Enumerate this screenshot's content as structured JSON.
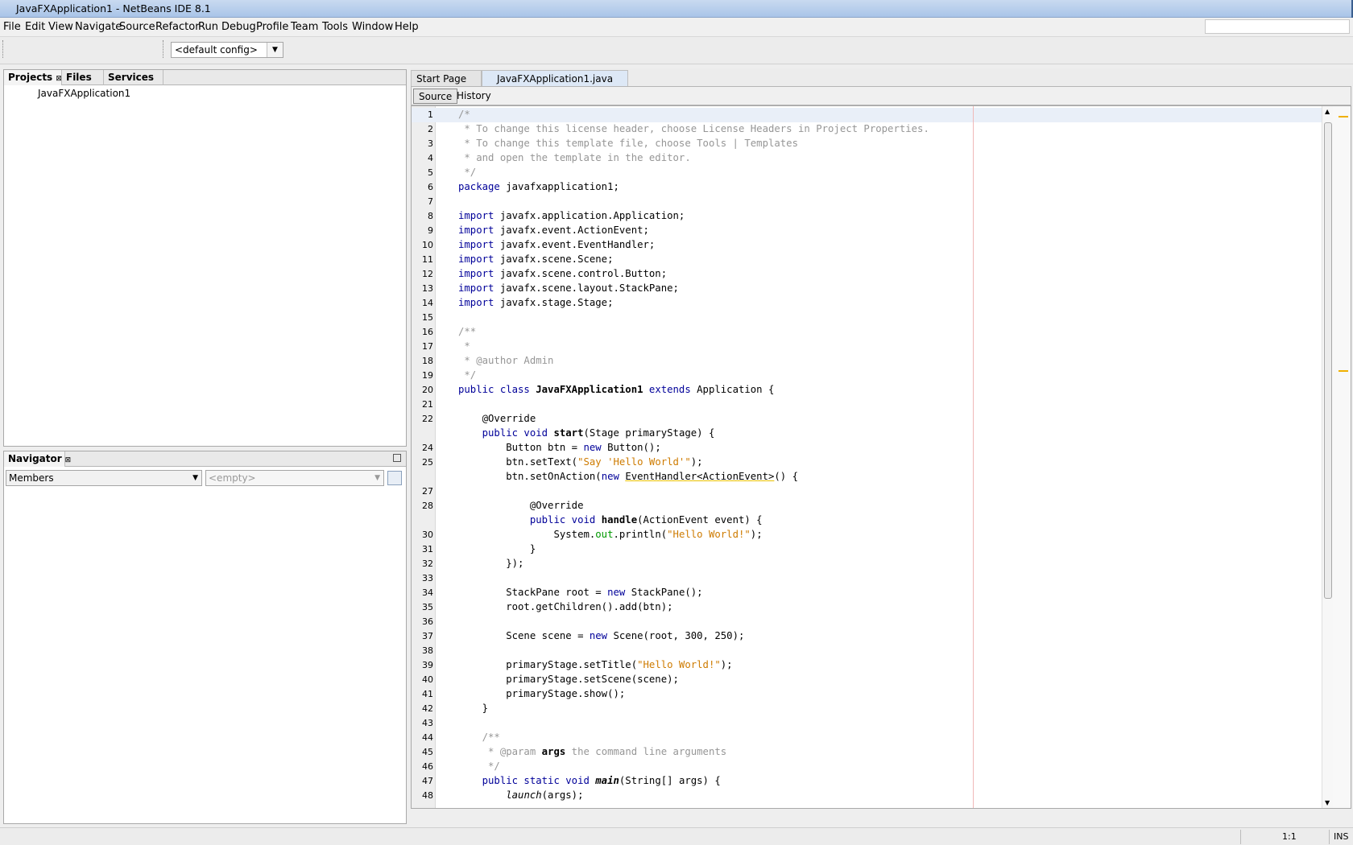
{
  "window": {
    "title": "JavaFXApplication1 - NetBeans IDE 8.1"
  },
  "menu": [
    "File",
    "Edit",
    "View",
    "Navigate",
    "Source",
    "Refactor",
    "Run",
    "Debug",
    "Profile",
    "Team",
    "Tools",
    "Window",
    "Help"
  ],
  "toolbar": {
    "config_value": "<default config>"
  },
  "projects_panel": {
    "tabs": [
      "Projects",
      "Files",
      "Services"
    ],
    "tree": [
      "JavaFXApplication1"
    ]
  },
  "navigator_panel": {
    "title": "Navigator",
    "filter_value": "Members",
    "empty_value": "<empty>"
  },
  "editor": {
    "tabs": [
      "Start Page",
      "JavaFXApplication1.java"
    ],
    "subtabs": [
      "Source",
      "History"
    ],
    "cursor_position": "1:1",
    "insert_mode": "INS",
    "lines": [
      {
        "n": "1",
        "code": [
          [
            "cm",
            "/*"
          ]
        ]
      },
      {
        "n": "2",
        "code": [
          [
            "cm",
            " * To change this license header, choose License Headers in Project Properties."
          ]
        ]
      },
      {
        "n": "3",
        "code": [
          [
            "cm",
            " * To change this template file, choose Tools | Templates"
          ]
        ]
      },
      {
        "n": "4",
        "code": [
          [
            "cm",
            " * and open the template in the editor."
          ]
        ]
      },
      {
        "n": "5",
        "code": [
          [
            "cm",
            " */"
          ]
        ]
      },
      {
        "n": "6",
        "code": [
          [
            "kw",
            "package"
          ],
          [
            "",
            " javafxapplication1;"
          ]
        ]
      },
      {
        "n": "7",
        "code": []
      },
      {
        "n": "8",
        "code": [
          [
            "kw",
            "import"
          ],
          [
            "",
            " javafx.application.Application;"
          ]
        ]
      },
      {
        "n": "9",
        "code": [
          [
            "kw",
            "import"
          ],
          [
            "",
            " javafx.event.ActionEvent;"
          ]
        ]
      },
      {
        "n": "10",
        "code": [
          [
            "kw",
            "import"
          ],
          [
            "",
            " javafx.event.EventHandler;"
          ]
        ]
      },
      {
        "n": "11",
        "code": [
          [
            "kw",
            "import"
          ],
          [
            "",
            " javafx.scene.Scene;"
          ]
        ]
      },
      {
        "n": "12",
        "code": [
          [
            "kw",
            "import"
          ],
          [
            "",
            " javafx.scene.control.Button;"
          ]
        ]
      },
      {
        "n": "13",
        "code": [
          [
            "kw",
            "import"
          ],
          [
            "",
            " javafx.scene.layout.StackPane;"
          ]
        ]
      },
      {
        "n": "14",
        "code": [
          [
            "kw",
            "import"
          ],
          [
            "",
            " javafx.stage.Stage;"
          ]
        ]
      },
      {
        "n": "15",
        "code": []
      },
      {
        "n": "16",
        "code": [
          [
            "cm",
            "/**"
          ]
        ]
      },
      {
        "n": "17",
        "code": [
          [
            "cm",
            " *"
          ]
        ]
      },
      {
        "n": "18",
        "code": [
          [
            "cm",
            " * @author Admin"
          ]
        ]
      },
      {
        "n": "19",
        "code": [
          [
            "cm",
            " */"
          ]
        ]
      },
      {
        "n": "20",
        "code": [
          [
            "kw",
            "public class "
          ],
          [
            "bold",
            "JavaFXApplication1"
          ],
          [
            "kw",
            " extends"
          ],
          [
            "",
            " Application {"
          ]
        ]
      },
      {
        "n": "21",
        "code": []
      },
      {
        "n": "22",
        "code": [
          [
            "",
            "    @Override"
          ]
        ]
      },
      {
        "n": "",
        "code": [
          [
            "kw",
            "    public void "
          ],
          [
            "bold",
            "start"
          ],
          [
            "",
            "(Stage primaryStage) {"
          ]
        ]
      },
      {
        "n": "24",
        "code": [
          [
            "",
            "        Button btn = "
          ],
          [
            "kw",
            "new"
          ],
          [
            "",
            " Button();"
          ]
        ]
      },
      {
        "n": "25",
        "code": [
          [
            "",
            "        btn.setText("
          ],
          [
            "str",
            "\"Say 'Hello World'\""
          ],
          [
            "",
            ");"
          ]
        ]
      },
      {
        "n": "",
        "code": [
          [
            "",
            "        btn.setOnAction("
          ],
          [
            "kw",
            "new"
          ],
          [
            "",
            " "
          ],
          [
            "warn",
            "EventHandler<ActionEvent>"
          ],
          [
            "",
            "() {"
          ]
        ]
      },
      {
        "n": "27",
        "code": []
      },
      {
        "n": "28",
        "code": [
          [
            "",
            "            @Override"
          ]
        ]
      },
      {
        "n": "",
        "code": [
          [
            "kw",
            "            public void "
          ],
          [
            "bold",
            "handle"
          ],
          [
            "",
            "(ActionEvent event) {"
          ]
        ]
      },
      {
        "n": "30",
        "code": [
          [
            "",
            "                System."
          ],
          [
            "fld",
            "out"
          ],
          [
            "",
            ".println("
          ],
          [
            "str",
            "\"Hello World!\""
          ],
          [
            "",
            ");"
          ]
        ]
      },
      {
        "n": "31",
        "code": [
          [
            "",
            "            }"
          ]
        ]
      },
      {
        "n": "32",
        "code": [
          [
            "",
            "        });"
          ]
        ]
      },
      {
        "n": "33",
        "code": []
      },
      {
        "n": "34",
        "code": [
          [
            "",
            "        StackPane root = "
          ],
          [
            "kw",
            "new"
          ],
          [
            "",
            " StackPane();"
          ]
        ]
      },
      {
        "n": "35",
        "code": [
          [
            "",
            "        root.getChildren().add(btn);"
          ]
        ]
      },
      {
        "n": "36",
        "code": []
      },
      {
        "n": "37",
        "code": [
          [
            "",
            "        Scene scene = "
          ],
          [
            "kw",
            "new"
          ],
          [
            "",
            " Scene(root, 300, 250);"
          ]
        ]
      },
      {
        "n": "38",
        "code": []
      },
      {
        "n": "39",
        "code": [
          [
            "",
            "        primaryStage.setTitle("
          ],
          [
            "str",
            "\"Hello World!\""
          ],
          [
            "",
            ");"
          ]
        ]
      },
      {
        "n": "40",
        "code": [
          [
            "",
            "        primaryStage.setScene(scene);"
          ]
        ]
      },
      {
        "n": "41",
        "code": [
          [
            "",
            "        primaryStage.show();"
          ]
        ]
      },
      {
        "n": "42",
        "code": [
          [
            "",
            "    }"
          ]
        ]
      },
      {
        "n": "43",
        "code": []
      },
      {
        "n": "44",
        "code": [
          [
            "cm",
            "    /**"
          ]
        ]
      },
      {
        "n": "45",
        "code": [
          [
            "cm",
            "     * @param "
          ],
          [
            "bold",
            "args"
          ],
          [
            "cm",
            " the command line arguments"
          ]
        ]
      },
      {
        "n": "46",
        "code": [
          [
            "cm",
            "     */"
          ]
        ]
      },
      {
        "n": "47",
        "code": [
          [
            "kw",
            "    public static void "
          ],
          [
            "bolditalic",
            "main"
          ],
          [
            "",
            "(String[] args) {"
          ]
        ]
      },
      {
        "n": "48",
        "code": [
          [
            "",
            "        "
          ],
          [
            "italic",
            "launch"
          ],
          [
            "",
            "(args);"
          ]
        ]
      }
    ]
  }
}
